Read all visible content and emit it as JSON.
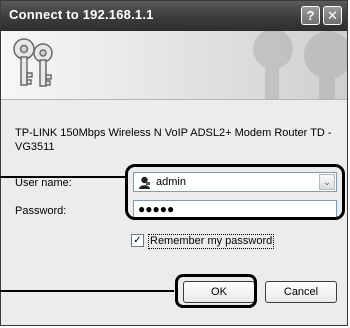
{
  "window": {
    "title": "Connect to 192.168.1.1",
    "help_label": "?",
    "close_label": "✕"
  },
  "description": "TP-LINK 150Mbps Wireless N VoIP ADSL2+ Modem Router TD -VG3511",
  "username": {
    "label": "User name:",
    "value": "admin",
    "dropdown_glyph": "⌄"
  },
  "password": {
    "label": "Password:",
    "value": "●●●●●"
  },
  "remember": {
    "label": "Remember my password",
    "checked_glyph": "✓"
  },
  "buttons": {
    "ok": "OK",
    "cancel": "Cancel"
  },
  "icons": {
    "banner": "keys-icon",
    "user": "user-icon"
  }
}
